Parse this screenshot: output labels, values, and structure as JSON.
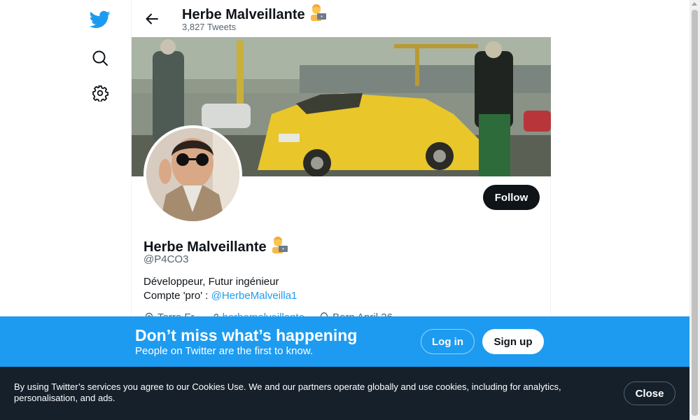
{
  "nav": {
    "items": [
      {
        "icon": "twitter-logo-icon"
      },
      {
        "icon": "search-icon"
      },
      {
        "icon": "settings-gear-icon"
      }
    ]
  },
  "header": {
    "title": "Herbe Malveillante",
    "tweet_count": "3,827 Tweets",
    "emoji": "technologist-emoji-icon"
  },
  "profile": {
    "name": "Herbe Malveillante",
    "handle": "@P4CO3",
    "bio_line1": "Développeur, Futur ingénieur",
    "bio_line2_prefix": "Compte 'pro' : ",
    "bio_link": "@HerbeMalveilla1",
    "meta_location": "Terre Fr",
    "meta_link": "herbemalveillante",
    "meta_birthday": "Born April 26",
    "follow_label": "Follow"
  },
  "cta": {
    "title": "Don’t miss what’s happening",
    "subtitle": "People on Twitter are the first to know.",
    "login_label": "Log in",
    "signup_label": "Sign up"
  },
  "cookie": {
    "text": "By using Twitter’s services you agree to our Cookies Use. We and our partners operate globally and use cookies, including for analytics, personalisation, and ads.",
    "close_label": "Close"
  },
  "colors": {
    "brand": "#1d9bf0",
    "dark": "#0f1419",
    "muted": "#536471",
    "cookie_bg": "#15202b"
  }
}
